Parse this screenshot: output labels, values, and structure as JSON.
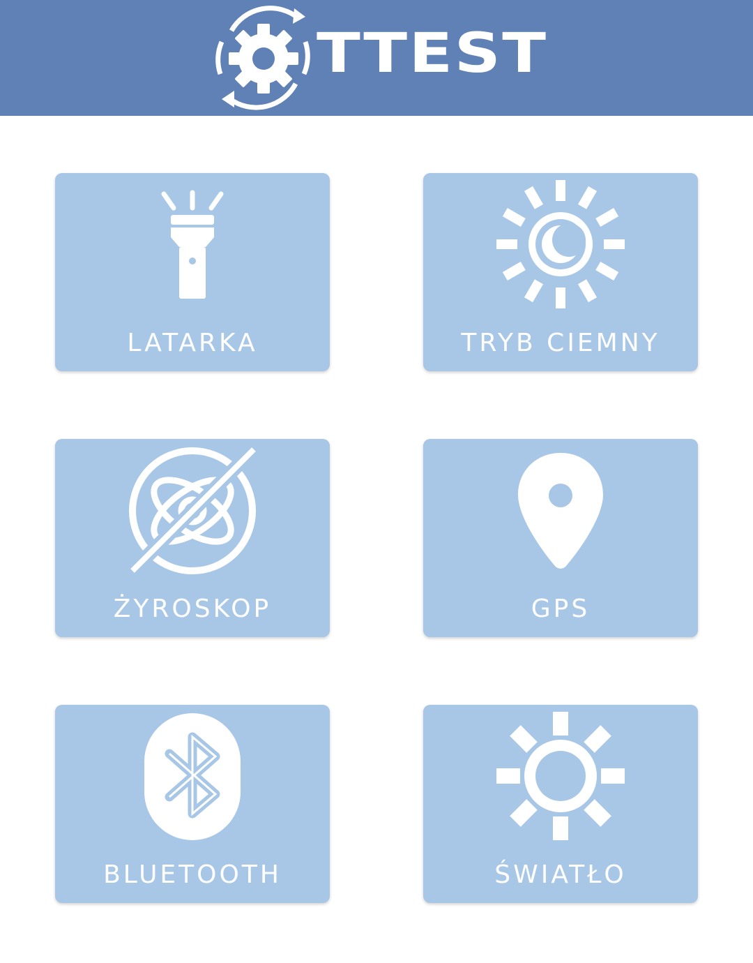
{
  "header": {
    "logo_text": "TTEST",
    "logo_icon": "gear-sync-icon",
    "background": "#5f81b6"
  },
  "tiles": [
    {
      "label": "LATARKA",
      "icon": "flashlight-icon"
    },
    {
      "label": "TRYB CIEMNY",
      "icon": "dark-mode-icon"
    },
    {
      "label": "ŻYROSKOP",
      "icon": "gyroscope-off-icon"
    },
    {
      "label": "GPS",
      "icon": "location-pin-icon"
    },
    {
      "label": "BLUETOOTH",
      "icon": "bluetooth-icon"
    },
    {
      "label": "ŚWIATŁO",
      "icon": "sun-icon"
    }
  ],
  "colors": {
    "tile_background": "#a8c7e6",
    "icon_color": "#ffffff",
    "page_background": "#ffffff"
  }
}
